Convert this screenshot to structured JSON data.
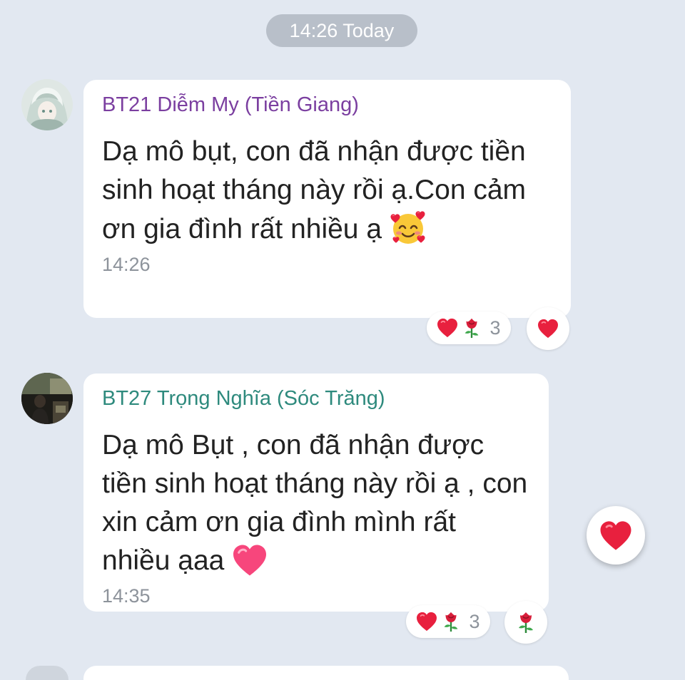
{
  "date_separator": "14:26 Today",
  "messages": [
    {
      "sender": "BT21 Diễm My (Tiền Giang)",
      "sender_color": "#7b3fa0",
      "text": "Dạ mô bụt, con đã nhận được tiền sinh hoạt tháng này rồi ạ.Con cảm ơn gia đình rất nhiều ạ",
      "emoji": "smiling-face-with-hearts",
      "time": "14:26",
      "reactions": {
        "icons": [
          "heart",
          "rose"
        ],
        "count": "3"
      },
      "my_reaction": "heart"
    },
    {
      "sender": "BT27 Trọng Nghĩa (Sóc Trăng)",
      "sender_color": "#2e8a7d",
      "text": "Dạ mô Bụt , con đã nhận được tiền sinh hoạt tháng này rồi ạ , con xin cảm ơn gia đình mình rất nhiều ạaa",
      "emoji": "pink-heart",
      "time": "14:35",
      "reactions": {
        "icons": [
          "heart",
          "rose"
        ],
        "count": "3"
      },
      "my_reaction": "rose"
    }
  ],
  "quick_reaction": "heart",
  "colors": {
    "background": "#e2e8f1",
    "bubble": "#ffffff",
    "heart": "#e8203e",
    "timestamp": "#8d939b"
  }
}
